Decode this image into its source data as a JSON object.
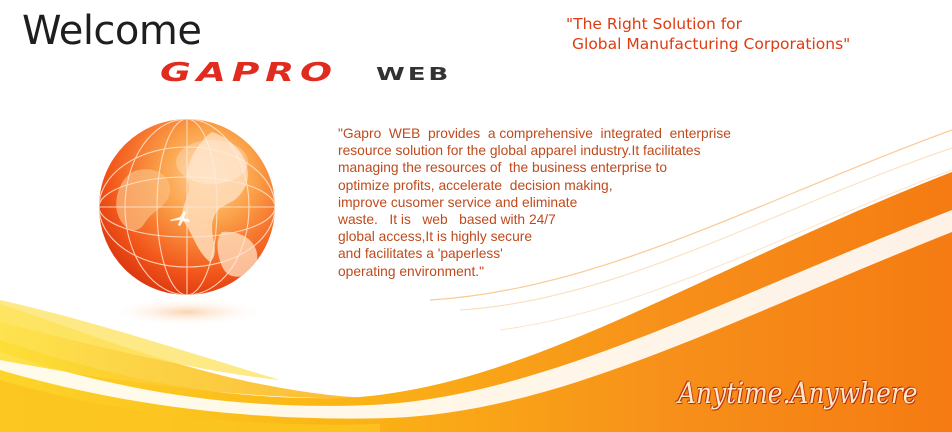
{
  "header": {
    "welcome": "Welcome",
    "brand_primary": "GAPRO",
    "brand_secondary": "WEB"
  },
  "tagline": {
    "line1": "\"The Right Solution for",
    "line2": "Global Manufacturing Corporations\""
  },
  "description": {
    "lines": [
      "\"Gapro  WEB  provides  a comprehensive  integrated  enterprise",
      "resource solution for the global apparel industry.It facilitates",
      "managing the resources of  the business enterprise to",
      "optimize profits, accelerate  decision making,",
      "improve cusomer service and eliminate",
      "waste.   It is   web   based with 24/7",
      "global access,It is highly secure",
      "and facilitates a 'paperless'",
      "operating environment.\""
    ]
  },
  "footer": {
    "motto": "Anytime.Anywhere"
  },
  "colors": {
    "accent_red": "#e02b1e",
    "accent_orange": "#f58a10",
    "accent_yellow": "#fcd116",
    "text_body": "#c04a1c"
  },
  "icons": {
    "globe": "globe-icon"
  }
}
